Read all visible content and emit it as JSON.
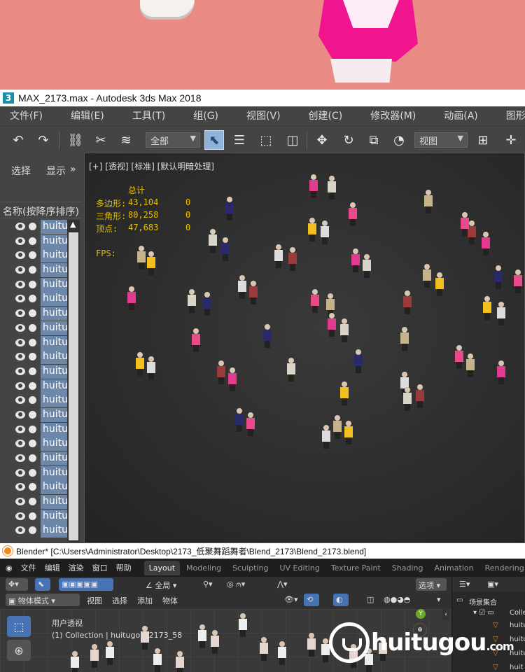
{
  "max": {
    "title": "MAX_2173.max - Autodesk 3ds Max 2018",
    "app_icon": "3",
    "menu": [
      "文件(F)",
      "编辑(E)",
      "工具(T)",
      "组(G)",
      "视图(V)",
      "创建(C)",
      "修改器(M)",
      "动画(A)",
      "图形编辑器"
    ],
    "toolbar": {
      "filter_dropdown": "全部",
      "refcoord_dropdown": "视图"
    },
    "scene_explorer": {
      "tab_select": "选择",
      "tab_display": "显示",
      "column_header": "名称(按降序排序)",
      "items": [
        "huitu",
        "huitu",
        "huitu",
        "huitu",
        "huitu",
        "huitu",
        "huitu",
        "huitu",
        "huitu",
        "huitu",
        "huitu",
        "huitu",
        "huitu",
        "huitu",
        "huitu",
        "huitu",
        "huitu",
        "huitu",
        "huitu",
        "huitu",
        "huitu",
        "huitu"
      ]
    },
    "viewport": {
      "label": "[+] [透视] [标准] [默认明暗处理]",
      "stats": {
        "header": "总计",
        "rows": [
          {
            "label": "多边形:",
            "value": "43,104",
            "sel": "0"
          },
          {
            "label": "三角形:",
            "value": "80,258",
            "sel": "0"
          },
          {
            "label": "顶点:",
            "value": "47,683",
            "sel": "0"
          }
        ],
        "fps_label": "FPS:"
      }
    }
  },
  "blender": {
    "title": "Blender* [C:\\Users\\Administrator\\Desktop\\2173_低聚舞蹈舞者\\Blend_2173\\Blend_2173.blend]",
    "menu": [
      "文件",
      "编辑",
      "渲染",
      "窗口",
      "帮助"
    ],
    "workspaces": [
      "Layout",
      "Modeling",
      "Sculpting",
      "UV Editing",
      "Texture Paint",
      "Shading",
      "Animation",
      "Rendering"
    ],
    "active_workspace": "Layout",
    "header": {
      "transform_orientation": "全局",
      "options": "选项",
      "mode": "物体模式",
      "view": "视图",
      "select": "选择",
      "add": "添加",
      "object": "物体"
    },
    "viewport": {
      "perspective": "用户透视",
      "collection_info": "(1) Collection | huitugou_2173_58",
      "axis_y": "Y"
    },
    "outliner": {
      "scene_collection": "场景集合",
      "collection": "Colle",
      "items": [
        "huitu",
        "huitu",
        "huitu",
        "huit"
      ]
    }
  },
  "watermark": {
    "text": "huitugou",
    "suffix": ".com"
  }
}
